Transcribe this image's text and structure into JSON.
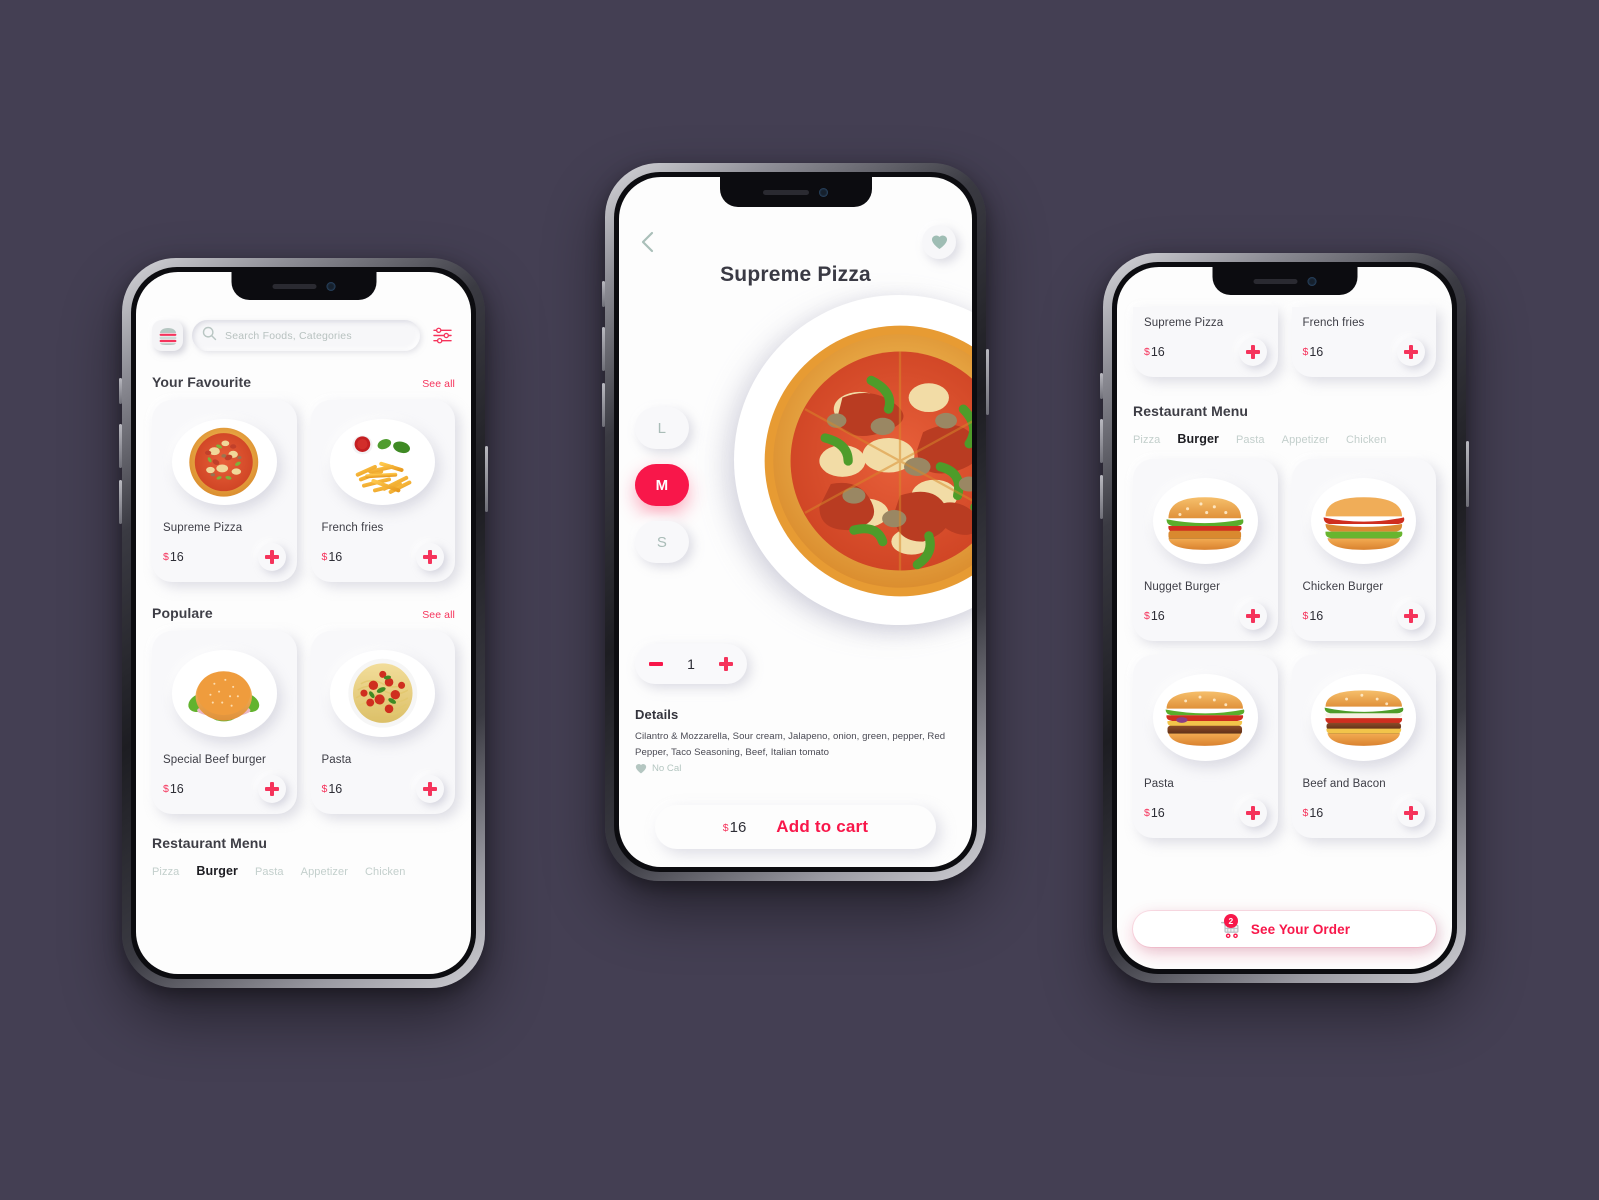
{
  "accent": {
    "red": "#f8174a",
    "pink": "#f5335b",
    "sage": "#b4c6c1",
    "background": "#443f53",
    "text_dark": "#3d3d45"
  },
  "home_screen": {
    "logo_icon": "burger-logo-icon",
    "search": {
      "icon": "search-icon",
      "placeholder": "Search Foods, Categories",
      "value": ""
    },
    "filter_icon": "filter-sliders-icon",
    "sections": [
      {
        "title": "Your Favourite",
        "see_all": "See all",
        "items": [
          {
            "name": "Supreme Pizza",
            "price": "16",
            "currency": "$",
            "art": "pizza",
            "add_icon": "plus-icon"
          },
          {
            "name": "French fries",
            "price": "16",
            "currency": "$",
            "art": "fries",
            "add_icon": "plus-icon"
          }
        ]
      },
      {
        "title": "Populare",
        "see_all": "See all",
        "items": [
          {
            "name": "Special Beef burger",
            "price": "16",
            "currency": "$",
            "art": "burger-bun",
            "add_icon": "plus-icon"
          },
          {
            "name": "Pasta",
            "price": "16",
            "currency": "$",
            "art": "pasta",
            "add_icon": "plus-icon"
          }
        ]
      }
    ],
    "menu": {
      "title": "Restaurant Menu",
      "tabs": [
        "Pizza",
        "Burger",
        "Pasta",
        "Appetizer",
        "Chicken"
      ],
      "active_tab": "Burger"
    }
  },
  "detail_screen": {
    "back_icon": "chevron-left-icon",
    "favorite_icon": "heart-icon",
    "title": "Supreme Pizza",
    "product_art": "pizza-large",
    "sizes": [
      "L",
      "M",
      "S"
    ],
    "selected_size": "M",
    "quantity": "1",
    "decrement_icon": "minus-icon",
    "increment_icon": "plus-icon",
    "details_heading": "Details",
    "details_text": "Cilantro & Mozzarella, Sour cream, Jalapeno, onion, green, pepper, Red Pepper, Taco Seasoning, Beef, Italian tomato",
    "nocal_icon": "heart-icon",
    "nocal_label": "No Cal",
    "cart": {
      "currency": "$",
      "price": "16",
      "cta": "Add to cart"
    }
  },
  "menu_screen": {
    "partial_items": [
      {
        "name": "Supreme Pizza",
        "price": "16",
        "currency": "$",
        "add_icon": "plus-icon"
      },
      {
        "name": "French fries",
        "price": "16",
        "currency": "$",
        "add_icon": "plus-icon"
      }
    ],
    "menu_title": "Restaurant Menu",
    "tabs": [
      "Pizza",
      "Burger",
      "Pasta",
      "Appetizer",
      "Chicken"
    ],
    "active_tab": "Burger",
    "items": [
      {
        "name": "Nugget Burger",
        "price": "16",
        "currency": "$",
        "art": "burger-nugget",
        "add_icon": "plus-icon"
      },
      {
        "name": "Chicken Burger",
        "price": "16",
        "currency": "$",
        "art": "burger-chicken",
        "add_icon": "plus-icon"
      },
      {
        "name": "Pasta",
        "price": "16",
        "currency": "$",
        "art": "burger-double",
        "add_icon": "plus-icon"
      },
      {
        "name": "Beef and Bacon",
        "price": "16",
        "currency": "$",
        "art": "burger-bacon",
        "add_icon": "plus-icon"
      }
    ],
    "order_button": {
      "icon": "shopping-cart-icon",
      "badge": "2",
      "label": "See Your Order"
    }
  }
}
